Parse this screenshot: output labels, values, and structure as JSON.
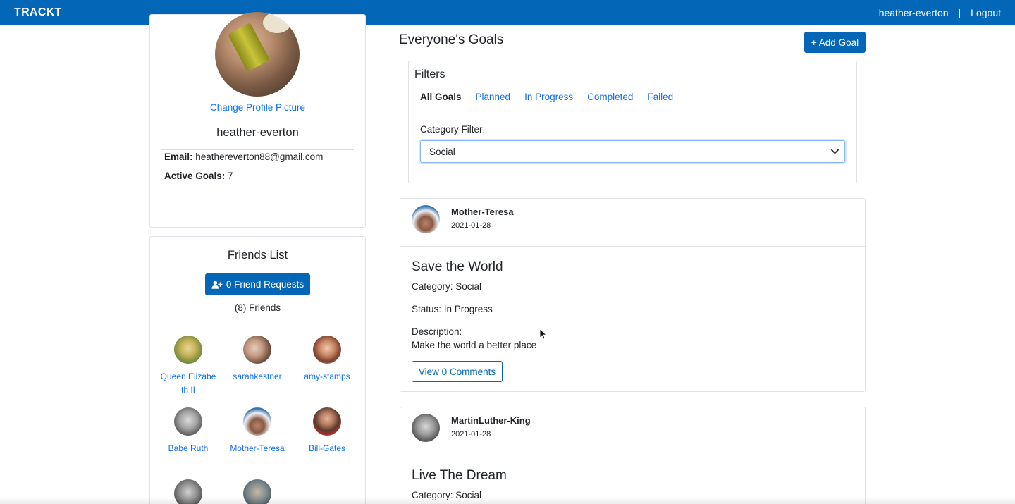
{
  "navbar": {
    "brand": "TRACKT",
    "username": "heather-everton",
    "separator": "|",
    "logout": "Logout",
    "color": "#0366b7"
  },
  "profile": {
    "change_picture": "Change Profile Picture",
    "name": "heather-everton",
    "email_label": "Email:",
    "email": "heathereverton88@gmail.com",
    "active_goals_label": "Active Goals:",
    "active_goals": "7"
  },
  "friends": {
    "title": "Friends List",
    "requests_button": "0 Friend Requests",
    "requests_icon": "user-plus-icon",
    "count_text": "(8) Friends",
    "items": [
      {
        "name": "Queen Elizabeth II"
      },
      {
        "name": "sarahkestner"
      },
      {
        "name": "amy-stamps"
      },
      {
        "name": "Babe Ruth"
      },
      {
        "name": "Mother-Teresa"
      },
      {
        "name": "Bill-Gates"
      },
      {
        "name": ""
      },
      {
        "name": ""
      }
    ]
  },
  "goals": {
    "title": "Everyone's Goals",
    "add_button": "+ Add Goal",
    "filters": {
      "title": "Filters",
      "tabs": [
        "All Goals",
        "Planned",
        "In Progress",
        "Completed",
        "Failed"
      ],
      "active_tab": "All Goals",
      "category_label": "Category Filter:",
      "category_value": "Social"
    },
    "cards": [
      {
        "user": "Mother-Teresa",
        "date": "2021-01-28",
        "title": "Save the World",
        "category": "Category: Social",
        "status": "Status: In Progress",
        "description_label": "Description:",
        "description": "Make the world a better place",
        "comments_button": "View 0 Comments"
      },
      {
        "user": "MartinLuther-King",
        "date": "2021-01-28",
        "title": "Live The Dream",
        "category": "Category: Social"
      }
    ]
  }
}
